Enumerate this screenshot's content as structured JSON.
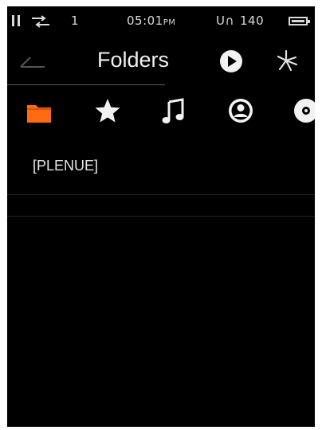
{
  "status": {
    "track_number": "1",
    "time": "05:01",
    "time_suffix": "PM",
    "signal": "U∩",
    "battery_value": "140"
  },
  "header": {
    "title": "Folders"
  },
  "tabs": [
    {
      "name": "folders",
      "active": true,
      "color": "#ff6a13"
    },
    {
      "name": "favorites",
      "active": false
    },
    {
      "name": "songs",
      "active": false
    },
    {
      "name": "artists",
      "active": false
    },
    {
      "name": "albums",
      "active": false
    }
  ],
  "list": {
    "items": [
      {
        "label": "[PLENUE]"
      }
    ]
  },
  "colors": {
    "background": "#000000",
    "accent": "#ff6a13",
    "text": "#e6e6e6"
  }
}
